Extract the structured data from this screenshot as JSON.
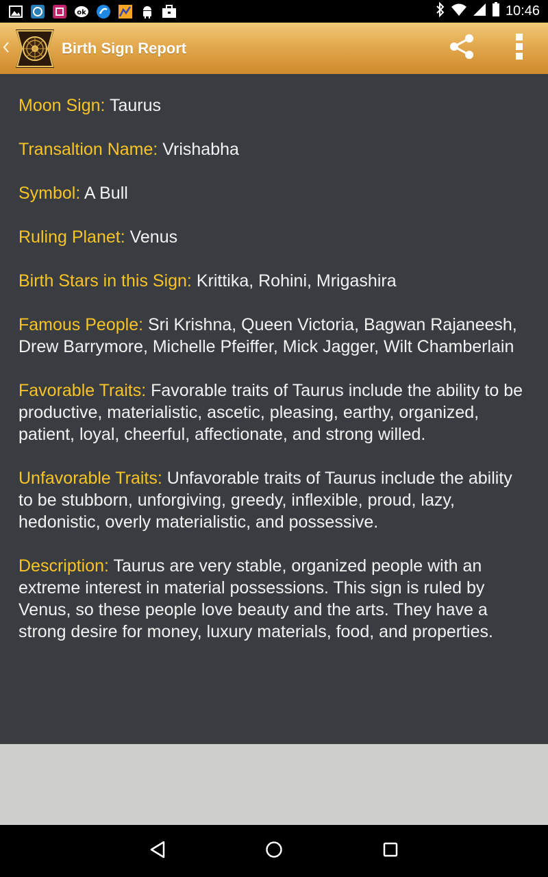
{
  "status_bar": {
    "time": "10:46",
    "icons": [
      "gallery-icon",
      "app-icon",
      "app-icon-pink",
      "ok-icon",
      "browser-icon",
      "chart-icon",
      "android-icon",
      "briefcase-icon",
      "bluetooth-icon",
      "wifi-icon",
      "signal-icon",
      "battery-icon"
    ]
  },
  "app_bar": {
    "title": "Birth Sign Report",
    "back_icon": "chevron-left-icon",
    "logo_icon": "astrology-wheel-logo",
    "share_icon": "share-icon",
    "menu_icon": "overflow-menu-icon"
  },
  "report": {
    "moon_sign": {
      "label": "Moon Sign:",
      "value": " Taurus"
    },
    "translation_name": {
      "label": "Transaltion Name:",
      "value": " Vrishabha"
    },
    "symbol": {
      "label": "Symbol:",
      "value": " A Bull"
    },
    "ruling_planet": {
      "label": "Ruling Planet:",
      "value": " Venus"
    },
    "birth_stars": {
      "label": "Birth Stars in this Sign:",
      "value": " Krittika, Rohini, Mrigashira"
    },
    "famous_people": {
      "label": "Famous People:",
      "value": " Sri Krishna, Queen Victoria, Bagwan Rajaneesh, Drew Barrymore, Michelle Pfeiffer, Mick Jagger, Wilt Chamberlain"
    },
    "favorable_traits": {
      "label": "Favorable Traits:",
      "value": " Favorable traits of Taurus include the ability to be productive, materialistic, ascetic, pleasing, earthy, organized, patient, loyal, cheerful, affectionate, and strong willed."
    },
    "unfavorable_traits": {
      "label": "Unfavorable Traits:",
      "value": " Unfavorable traits of Taurus include the ability to be stubborn, unforgiving, greedy, inflexible, proud, lazy, hedonistic, overly materialistic, and possessive."
    },
    "description": {
      "label": "Description:",
      "value": " Taurus are very stable, organized people with an extreme interest in material possessions. This sign is ruled by Venus, so these people love beauty and the arts. They have a strong desire for money, luxury materials, food, and properties."
    }
  },
  "nav_bar": {
    "back_icon": "back-triangle-icon",
    "home_icon": "home-circle-icon",
    "recents_icon": "recents-square-icon"
  },
  "colors": {
    "label": "#f7c325",
    "text": "#f2f2f2",
    "content_bg": "#393d41",
    "app_bar_top": "#f1c977",
    "app_bar_bottom": "#cf8a2c"
  }
}
